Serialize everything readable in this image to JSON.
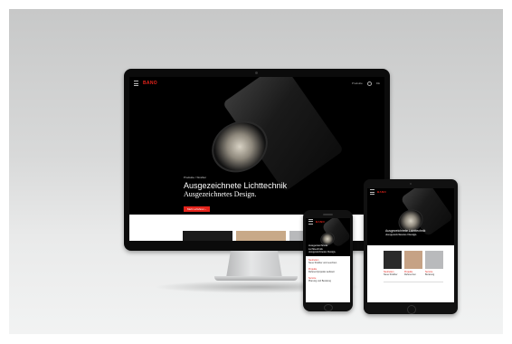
{
  "site": {
    "logo": "BANO",
    "nav_link": "Produkte",
    "nav_lang": "DE",
    "breadcrumb": "Produkte / Strahler",
    "headline_line1": "Ausgezeichnete Lichttechnik",
    "headline_line2": "Ausgezeichnetes Design.",
    "cta_label": "Mehr erfahren ›"
  },
  "phone": {
    "headline_line1": "Ausgezeichnete",
    "headline_line2": "Lichttechnik",
    "headline_line3": "Ausgezeichnetes Design.",
    "news": [
      {
        "tag": "Neuheiten",
        "text": "Neue Strahler und Leuchten"
      },
      {
        "tag": "Projekte",
        "text": "Referenzprojekte weltweit"
      },
      {
        "tag": "Service",
        "text": "Planung und Beratung"
      }
    ]
  },
  "tablet": {
    "headline_line1": "Ausgezeichnete Lichttechnik",
    "headline_line2": "Ausgezeichnetes Design.",
    "cards": [
      {
        "tag": "Neuheiten",
        "text": "Neue Strahler"
      },
      {
        "tag": "Projekte",
        "text": "Referenzen"
      },
      {
        "tag": "Service",
        "text": "Beratung"
      }
    ]
  },
  "colors": {
    "accent": "#e4231b",
    "screen_bg": "#000000",
    "backdrop": "#d8d9d9"
  },
  "icons": [
    "menu-icon",
    "search-icon"
  ]
}
